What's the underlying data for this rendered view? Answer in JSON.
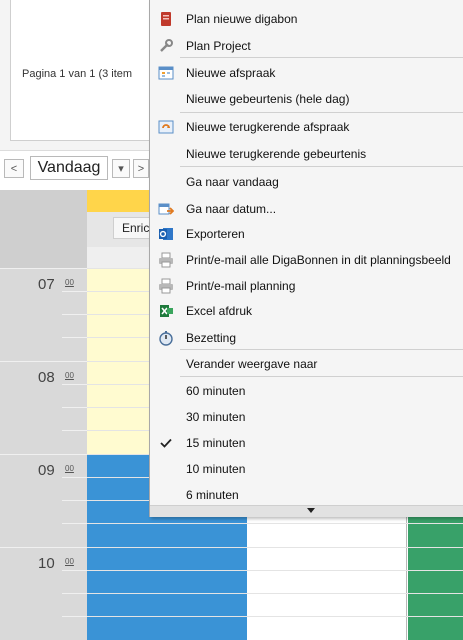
{
  "planner": {
    "pager_text": "Pagina 1 van 1 (3 item",
    "nav_prev": "<",
    "today_label": "Vandaag",
    "nav_dropdown": "▾",
    "nav_next": ">",
    "resource_label": "Enric",
    "hours": [
      {
        "hour": "07",
        "min": "00"
      },
      {
        "hour": "08",
        "min": "00"
      },
      {
        "hour": "09",
        "min": "00"
      },
      {
        "hour": "10",
        "min": "00"
      }
    ],
    "colors": {
      "header_yellow": "#ffd54a",
      "appt_blue": "#3a93d6",
      "appt_green": "#38a169"
    }
  },
  "menu": {
    "items": [
      {
        "label": "Plan nieuwe digabon",
        "icon": "digabon-icon"
      },
      {
        "label": "Plan Project",
        "icon": "wrench-icon"
      },
      {
        "label": "Nieuwe afspraak",
        "icon": "calendar-icon"
      },
      {
        "label": "Nieuwe gebeurtenis (hele dag)",
        "icon": ""
      },
      {
        "label": "Nieuwe terugkerende afspraak",
        "icon": "recurring-icon"
      },
      {
        "label": "Nieuwe terugkerende gebeurtenis",
        "icon": ""
      },
      {
        "label": "Ga naar vandaag",
        "icon": ""
      },
      {
        "label": "Ga naar datum...",
        "icon": "goto-date-icon"
      },
      {
        "label": "Exporteren",
        "icon": "outlook-icon"
      },
      {
        "label": "Print/e-mail alle DigaBonnen in dit planningsbeeld",
        "icon": "printer-icon"
      },
      {
        "label": "Print/e-mail planning",
        "icon": "printer-icon"
      },
      {
        "label": "Excel afdruk",
        "icon": "excel-icon"
      },
      {
        "label": "Bezetting",
        "icon": "stopwatch-icon"
      },
      {
        "label": "Verander weergave naar",
        "icon": ""
      },
      {
        "label": "60 minuten",
        "icon": ""
      },
      {
        "label": "30 minuten",
        "icon": ""
      },
      {
        "label": "15 minuten",
        "icon": "check-icon",
        "checked": true
      },
      {
        "label": "10 minuten",
        "icon": ""
      },
      {
        "label": "6 minuten",
        "icon": ""
      }
    ]
  }
}
